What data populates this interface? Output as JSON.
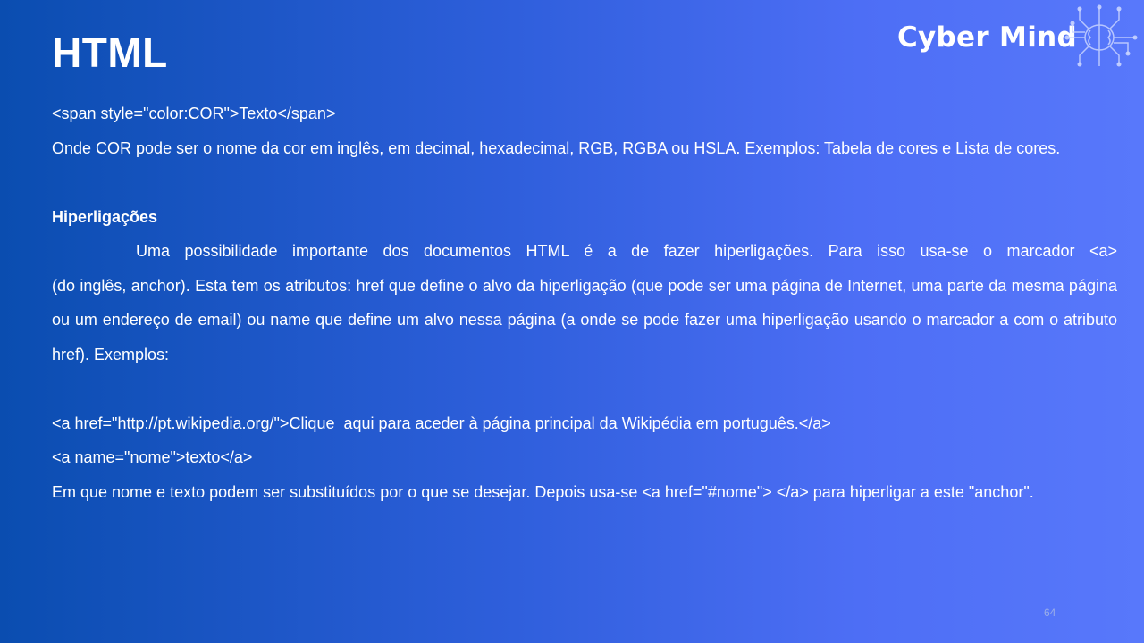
{
  "slide": {
    "title": "HTML",
    "logo_text": "Cyber Mind",
    "page_number": "64"
  },
  "content": {
    "span_example": "<span style=\"color:COR\">Texto</span>",
    "color_desc": "Onde COR pode ser o nome da cor em inglês, em decimal, hexadecimal, RGB, RGBA ou HSLA. Exemplos: Tabela de cores e Lista de cores.",
    "heading": "Hiperligações",
    "hyper_intro_first": "Uma possibilidade importante dos documentos HTML é a de fazer hiperligações. Para isso usa-se o marcador <a>",
    "hyper_intro_rest": "(do inglês, anchor). Esta tem os atributos: href que define o alvo da hiperligação (que pode ser uma página de Internet, uma parte da mesma página ou um endereço de email) ou name que define um alvo nessa página (a onde se pode fazer uma hiperligação usando o marcador a com o atributo href). Exemplos:",
    "example_href": "<a href=\"http://pt.wikipedia.org/\">Clique  aqui para aceder à página principal da Wikipédia em português.</a>",
    "example_name": "<a name=\"nome\">texto</a>",
    "closing": "Em que nome e texto podem ser substituídos por o que se desejar. Depois usa-se <a href=\"#nome\">  </a> para hiperligar a este \"anchor\"."
  },
  "icons": {
    "logo_icon": "brain-circuit-icon"
  }
}
